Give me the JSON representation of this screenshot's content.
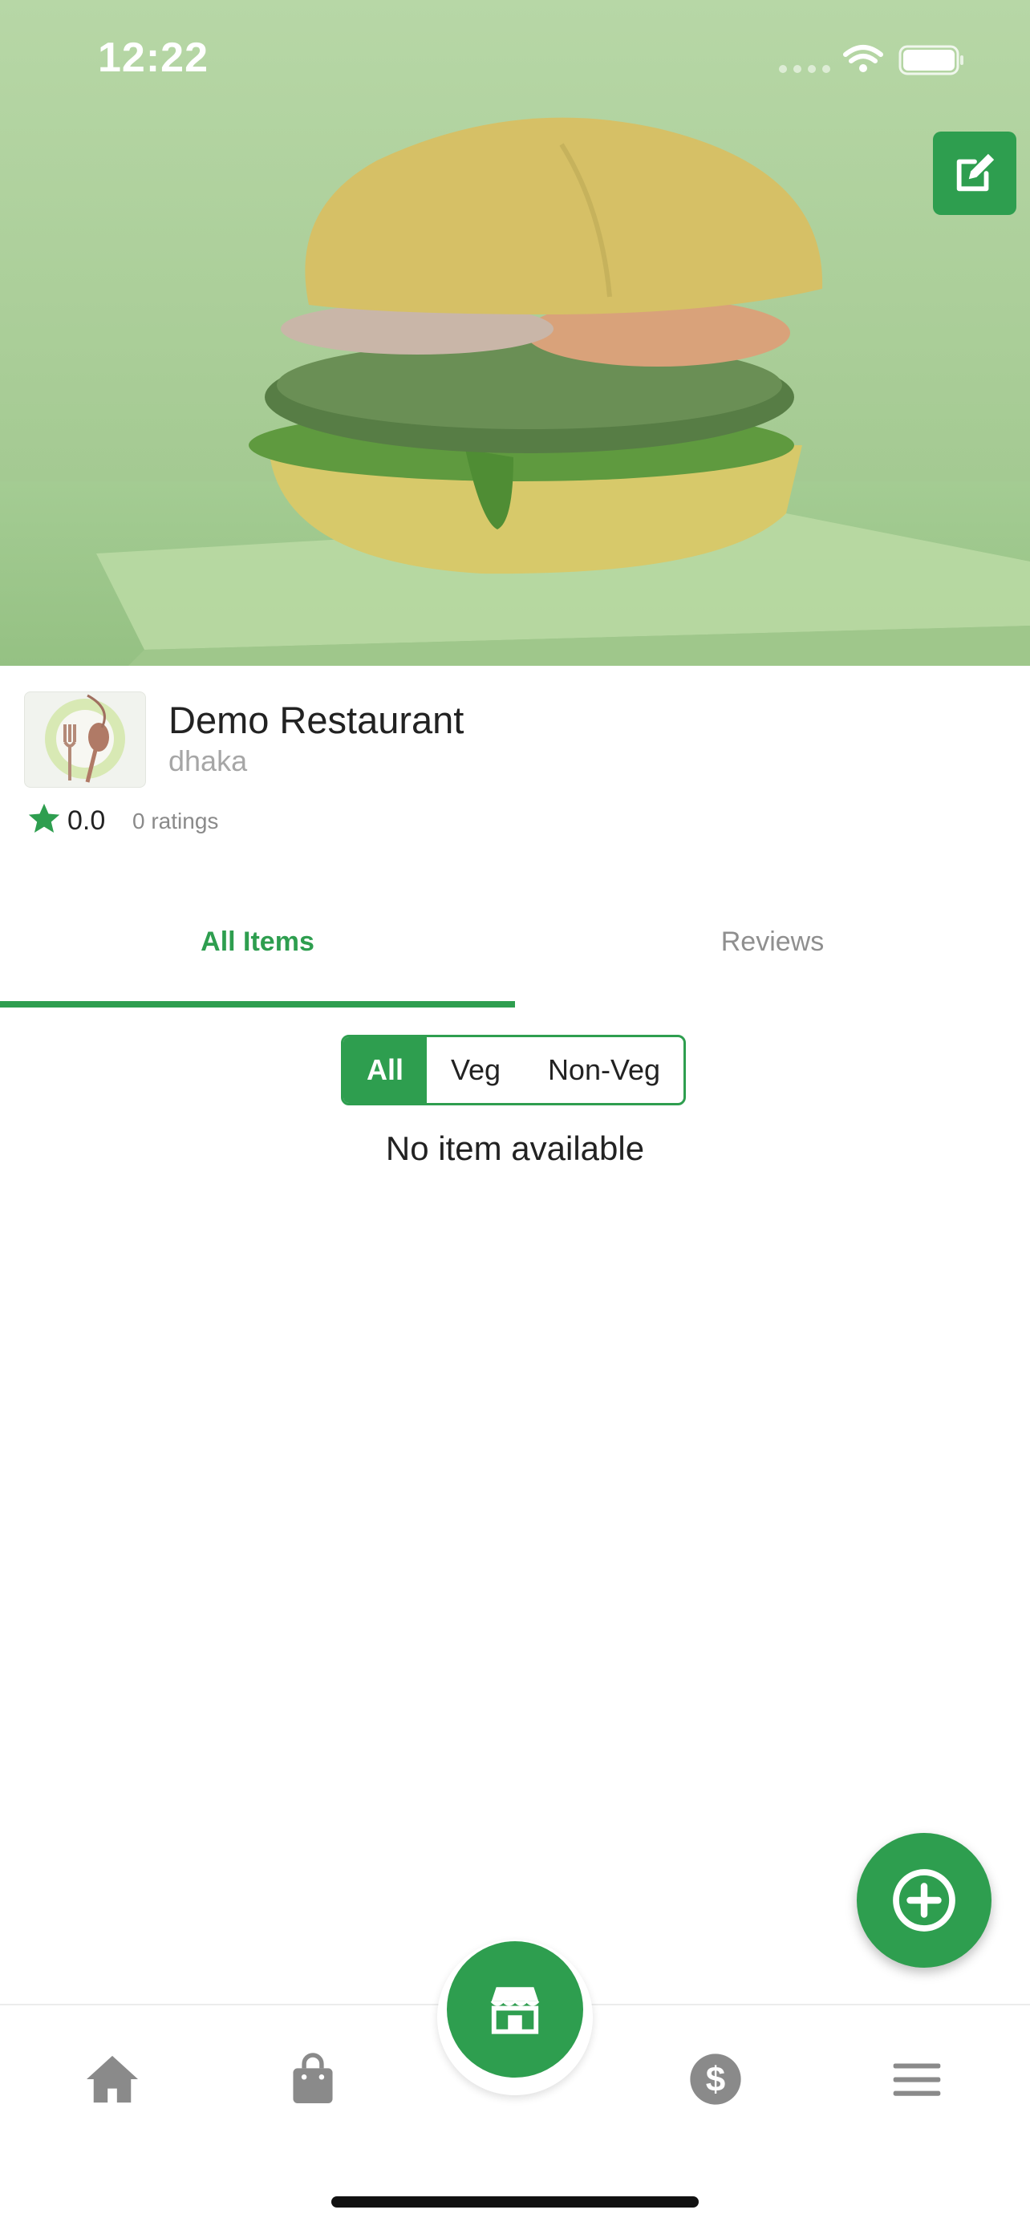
{
  "status_bar": {
    "time": "12:22"
  },
  "restaurant": {
    "name": "Demo Restaurant",
    "location": "dhaka",
    "rating": "0.0",
    "ratings_count": "0 ratings"
  },
  "tabs": [
    {
      "label": "All Items",
      "active": true
    },
    {
      "label": "Reviews",
      "active": false
    }
  ],
  "filter": {
    "options": [
      "All",
      "Veg",
      "Non-Veg"
    ],
    "selected": "All"
  },
  "empty_message": "No item available",
  "bottom_nav": {
    "items": [
      "home-icon",
      "shopping-bag-icon",
      "store-icon",
      "dollar-icon",
      "menu-icon"
    ],
    "active": "store-icon"
  },
  "colors": {
    "accent": "#2e9e4f",
    "muted": "#8f8f8f",
    "icon": "#8a8a8a"
  }
}
